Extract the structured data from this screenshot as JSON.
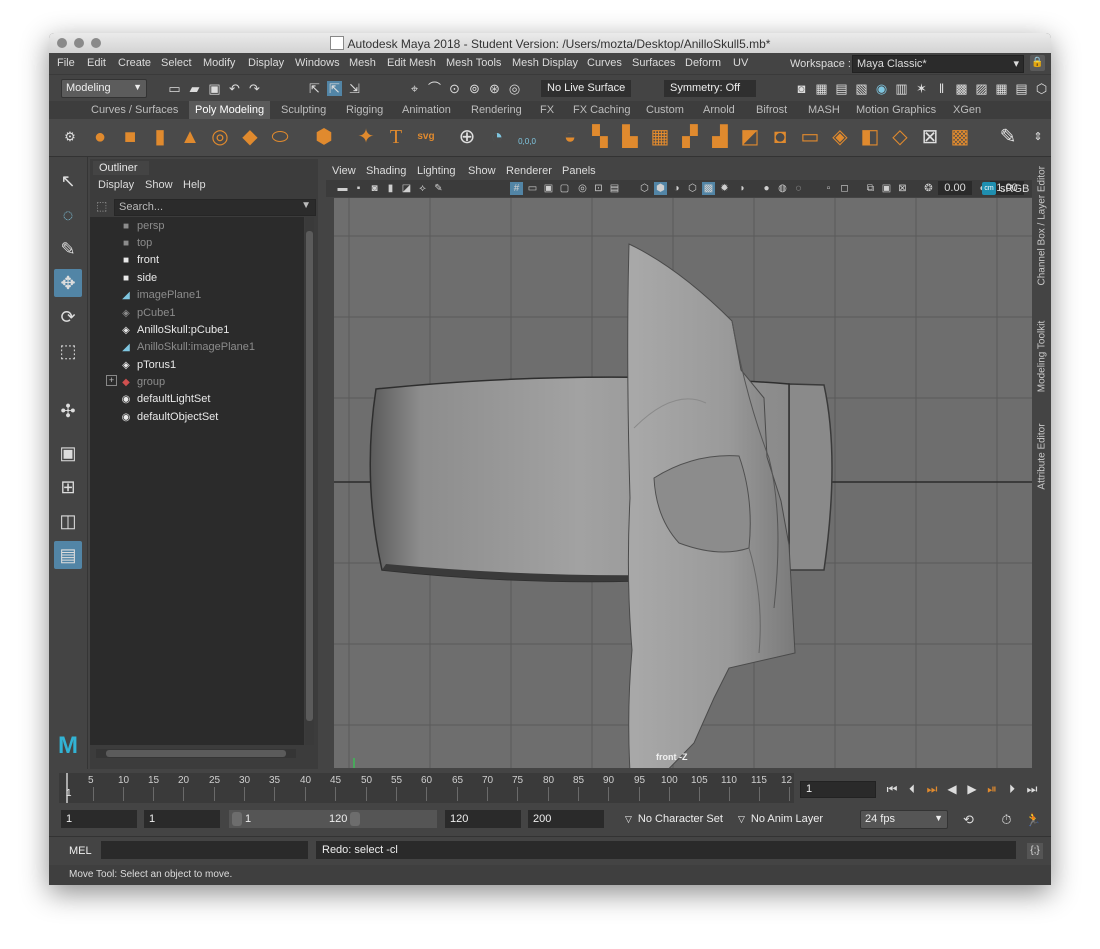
{
  "window": {
    "title": "Autodesk Maya 2018 - Student Version: /Users/mozta/Desktop/AnilloSkull5.mb*"
  },
  "menubar": {
    "items": [
      "File",
      "Edit",
      "Create",
      "Select",
      "Modify",
      "Display",
      "Windows",
      "Mesh",
      "Edit Mesh",
      "Mesh Tools",
      "Mesh Display",
      "Curves",
      "Surfaces",
      "Deform",
      "UV"
    ],
    "workspace_label": "Workspace :",
    "workspace_value": "Maya Classic*"
  },
  "statusline": {
    "menuset": "Modeling",
    "live_surface": "No Live Surface",
    "symmetry": "Symmetry: Off"
  },
  "shelf": {
    "tabs": [
      "Curves / Surfaces",
      "Poly Modeling",
      "Sculpting",
      "Rigging",
      "Animation",
      "Rendering",
      "FX",
      "FX Caching",
      "Custom",
      "Arnold",
      "Bifrost",
      "MASH",
      "Motion Graphics",
      "XGen"
    ],
    "active_tab": "Poly Modeling",
    "text_icon": "T",
    "svg_icon": "svg",
    "origin_label": "0,0,0"
  },
  "outliner": {
    "tab": "Outliner",
    "menu": [
      "Display",
      "Show",
      "Help"
    ],
    "search_placeholder": "Search...",
    "items": [
      {
        "label": "persp",
        "icon": "camera-icon",
        "dim": true
      },
      {
        "label": "top",
        "icon": "camera-icon",
        "dim": true
      },
      {
        "label": "front",
        "icon": "camera-icon",
        "dim": false
      },
      {
        "label": "side",
        "icon": "camera-icon",
        "dim": false
      },
      {
        "label": "imagePlane1",
        "icon": "image-plane-icon",
        "dim": true
      },
      {
        "label": "pCube1",
        "icon": "mesh-icon",
        "dim": true
      },
      {
        "label": "AnilloSkull:pCube1",
        "icon": "mesh-icon",
        "dim": false
      },
      {
        "label": "AnilloSkull:imagePlane1",
        "icon": "image-plane-icon",
        "dim": true
      },
      {
        "label": "pTorus1",
        "icon": "mesh-icon",
        "dim": false
      },
      {
        "label": "group",
        "icon": "group-icon",
        "dim": true
      },
      {
        "label": "defaultLightSet",
        "icon": "set-icon",
        "dim": false
      },
      {
        "label": "defaultObjectSet",
        "icon": "set-icon",
        "dim": false
      }
    ]
  },
  "panel": {
    "menu": [
      "View",
      "Shading",
      "Lighting",
      "Show",
      "Renderer",
      "Panels"
    ],
    "exposure": "0.00",
    "gamma": "1.00",
    "color_space": "sRGB g",
    "camera_label": "front -Z"
  },
  "right_tabs": [
    "Channel Box / Layer Editor",
    "Modeling Toolkit",
    "Attribute Editor"
  ],
  "timeslider": {
    "ticks": [
      "5",
      "10",
      "15",
      "20",
      "25",
      "30",
      "35",
      "40",
      "45",
      "50",
      "55",
      "60",
      "65",
      "70",
      "75",
      "80",
      "85",
      "90",
      "95",
      "100",
      "105",
      "110",
      "115",
      "12"
    ],
    "current_frame_marker": "1",
    "current_frame": "1"
  },
  "range": {
    "start": "1",
    "playback_start": "1",
    "slider_start": "1",
    "slider_end": "120",
    "playback_end": "120",
    "end": "200",
    "character_set": "No Character Set",
    "anim_layer": "No Anim Layer",
    "fps": "24 fps"
  },
  "cmdline": {
    "language": "MEL",
    "output": "Redo: select -cl"
  },
  "helpline": "Move Tool: Select an object to move.",
  "colors": {
    "accent": "#5285a6",
    "shelf_orange": "#e08a2e",
    "viewport_bg": "#6e6e6e"
  }
}
